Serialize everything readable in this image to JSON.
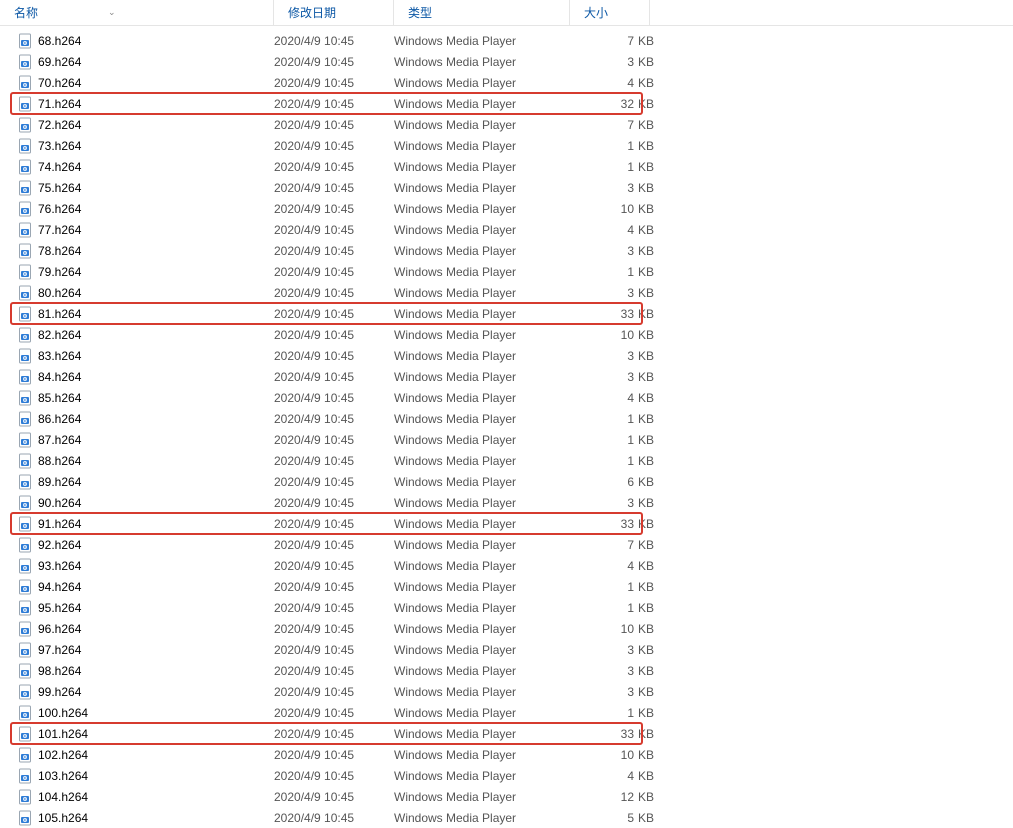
{
  "columns": {
    "name": "名称",
    "date": "修改日期",
    "type": "类型",
    "size": "大小"
  },
  "size_unit": "KB",
  "rows": [
    {
      "name": "68.h264",
      "date": "2020/4/9 10:45",
      "type": "Windows Media Player",
      "size": "7",
      "highlight": false
    },
    {
      "name": "69.h264",
      "date": "2020/4/9 10:45",
      "type": "Windows Media Player",
      "size": "3",
      "highlight": false
    },
    {
      "name": "70.h264",
      "date": "2020/4/9 10:45",
      "type": "Windows Media Player",
      "size": "4",
      "highlight": false
    },
    {
      "name": "71.h264",
      "date": "2020/4/9 10:45",
      "type": "Windows Media Player",
      "size": "32",
      "highlight": true
    },
    {
      "name": "72.h264",
      "date": "2020/4/9 10:45",
      "type": "Windows Media Player",
      "size": "7",
      "highlight": false
    },
    {
      "name": "73.h264",
      "date": "2020/4/9 10:45",
      "type": "Windows Media Player",
      "size": "1",
      "highlight": false
    },
    {
      "name": "74.h264",
      "date": "2020/4/9 10:45",
      "type": "Windows Media Player",
      "size": "1",
      "highlight": false
    },
    {
      "name": "75.h264",
      "date": "2020/4/9 10:45",
      "type": "Windows Media Player",
      "size": "3",
      "highlight": false
    },
    {
      "name": "76.h264",
      "date": "2020/4/9 10:45",
      "type": "Windows Media Player",
      "size": "10",
      "highlight": false
    },
    {
      "name": "77.h264",
      "date": "2020/4/9 10:45",
      "type": "Windows Media Player",
      "size": "4",
      "highlight": false
    },
    {
      "name": "78.h264",
      "date": "2020/4/9 10:45",
      "type": "Windows Media Player",
      "size": "3",
      "highlight": false
    },
    {
      "name": "79.h264",
      "date": "2020/4/9 10:45",
      "type": "Windows Media Player",
      "size": "1",
      "highlight": false
    },
    {
      "name": "80.h264",
      "date": "2020/4/9 10:45",
      "type": "Windows Media Player",
      "size": "3",
      "highlight": false
    },
    {
      "name": "81.h264",
      "date": "2020/4/9 10:45",
      "type": "Windows Media Player",
      "size": "33",
      "highlight": true
    },
    {
      "name": "82.h264",
      "date": "2020/4/9 10:45",
      "type": "Windows Media Player",
      "size": "10",
      "highlight": false
    },
    {
      "name": "83.h264",
      "date": "2020/4/9 10:45",
      "type": "Windows Media Player",
      "size": "3",
      "highlight": false
    },
    {
      "name": "84.h264",
      "date": "2020/4/9 10:45",
      "type": "Windows Media Player",
      "size": "3",
      "highlight": false
    },
    {
      "name": "85.h264",
      "date": "2020/4/9 10:45",
      "type": "Windows Media Player",
      "size": "4",
      "highlight": false
    },
    {
      "name": "86.h264",
      "date": "2020/4/9 10:45",
      "type": "Windows Media Player",
      "size": "1",
      "highlight": false
    },
    {
      "name": "87.h264",
      "date": "2020/4/9 10:45",
      "type": "Windows Media Player",
      "size": "1",
      "highlight": false
    },
    {
      "name": "88.h264",
      "date": "2020/4/9 10:45",
      "type": "Windows Media Player",
      "size": "1",
      "highlight": false
    },
    {
      "name": "89.h264",
      "date": "2020/4/9 10:45",
      "type": "Windows Media Player",
      "size": "6",
      "highlight": false
    },
    {
      "name": "90.h264",
      "date": "2020/4/9 10:45",
      "type": "Windows Media Player",
      "size": "3",
      "highlight": false
    },
    {
      "name": "91.h264",
      "date": "2020/4/9 10:45",
      "type": "Windows Media Player",
      "size": "33",
      "highlight": true
    },
    {
      "name": "92.h264",
      "date": "2020/4/9 10:45",
      "type": "Windows Media Player",
      "size": "7",
      "highlight": false
    },
    {
      "name": "93.h264",
      "date": "2020/4/9 10:45",
      "type": "Windows Media Player",
      "size": "4",
      "highlight": false
    },
    {
      "name": "94.h264",
      "date": "2020/4/9 10:45",
      "type": "Windows Media Player",
      "size": "1",
      "highlight": false
    },
    {
      "name": "95.h264",
      "date": "2020/4/9 10:45",
      "type": "Windows Media Player",
      "size": "1",
      "highlight": false
    },
    {
      "name": "96.h264",
      "date": "2020/4/9 10:45",
      "type": "Windows Media Player",
      "size": "10",
      "highlight": false
    },
    {
      "name": "97.h264",
      "date": "2020/4/9 10:45",
      "type": "Windows Media Player",
      "size": "3",
      "highlight": false
    },
    {
      "name": "98.h264",
      "date": "2020/4/9 10:45",
      "type": "Windows Media Player",
      "size": "3",
      "highlight": false
    },
    {
      "name": "99.h264",
      "date": "2020/4/9 10:45",
      "type": "Windows Media Player",
      "size": "3",
      "highlight": false
    },
    {
      "name": "100.h264",
      "date": "2020/4/9 10:45",
      "type": "Windows Media Player",
      "size": "1",
      "highlight": false
    },
    {
      "name": "101.h264",
      "date": "2020/4/9 10:45",
      "type": "Windows Media Player",
      "size": "33",
      "highlight": true
    },
    {
      "name": "102.h264",
      "date": "2020/4/9 10:45",
      "type": "Windows Media Player",
      "size": "10",
      "highlight": false
    },
    {
      "name": "103.h264",
      "date": "2020/4/9 10:45",
      "type": "Windows Media Player",
      "size": "4",
      "highlight": false
    },
    {
      "name": "104.h264",
      "date": "2020/4/9 10:45",
      "type": "Windows Media Player",
      "size": "12",
      "highlight": false
    },
    {
      "name": "105.h264",
      "date": "2020/4/9 10:45",
      "type": "Windows Media Player",
      "size": "5",
      "highlight": false
    }
  ]
}
